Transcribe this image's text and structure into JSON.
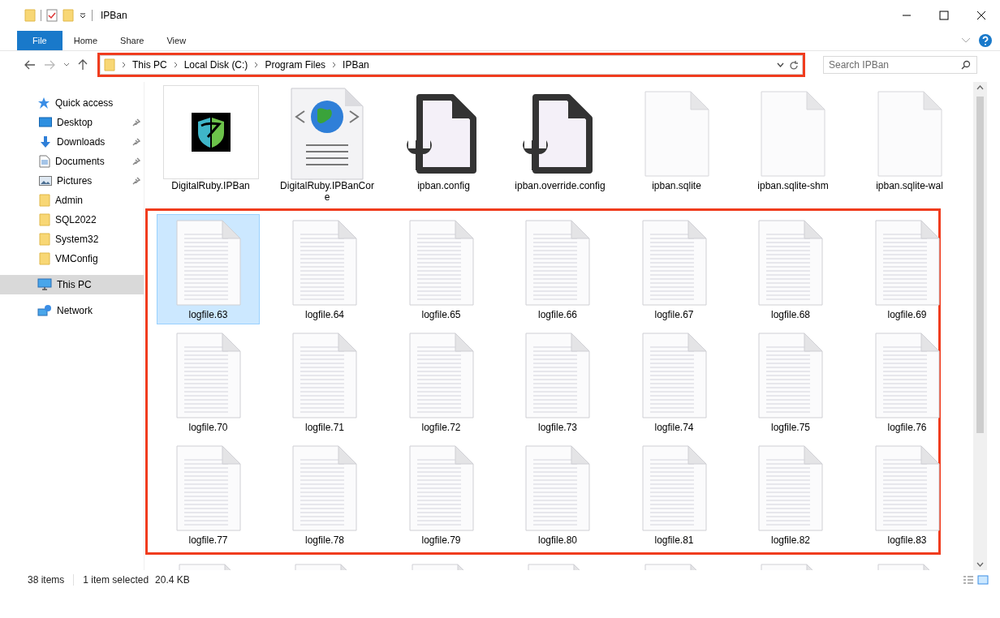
{
  "window": {
    "title": "IPBan"
  },
  "ribbon": {
    "tabs": [
      {
        "label": "File",
        "kind": "file"
      },
      {
        "label": "Home",
        "kind": "tab"
      },
      {
        "label": "Share",
        "kind": "tab"
      },
      {
        "label": "View",
        "kind": "tab"
      }
    ]
  },
  "address": {
    "crumbs": [
      "This PC",
      "Local Disk (C:)",
      "Program Files",
      "IPBan"
    ]
  },
  "search": {
    "placeholder": "Search IPBan"
  },
  "sidebar": {
    "items": [
      {
        "label": "Quick access",
        "kind": "star",
        "selected": false,
        "children": [
          {
            "label": "Desktop",
            "kind": "desktop",
            "pinned": true,
            "selected": false
          },
          {
            "label": "Downloads",
            "kind": "download",
            "pinned": true,
            "selected": false
          },
          {
            "label": "Documents",
            "kind": "documents",
            "pinned": true,
            "selected": false
          },
          {
            "label": "Pictures",
            "kind": "pictures",
            "pinned": true,
            "selected": false
          },
          {
            "label": "Admin",
            "kind": "folder",
            "pinned": false,
            "selected": false
          },
          {
            "label": "SQL2022",
            "kind": "folder",
            "pinned": false,
            "selected": false
          },
          {
            "label": "System32",
            "kind": "folder",
            "pinned": false,
            "selected": false
          },
          {
            "label": "VMConfig",
            "kind": "folder",
            "pinned": false,
            "selected": false
          }
        ]
      },
      {
        "label": "This PC",
        "kind": "pc",
        "selected": true
      },
      {
        "label": "Network",
        "kind": "network",
        "selected": false
      }
    ]
  },
  "files": [
    {
      "name": "DigitalRuby.IPBan",
      "kind": "logo",
      "selected": false
    },
    {
      "name": "DigitalRuby.IPBanCore",
      "kind": "web",
      "selected": false
    },
    {
      "name": "ipban.config",
      "kind": "config",
      "selected": false
    },
    {
      "name": "ipban.override.config",
      "kind": "config",
      "selected": false
    },
    {
      "name": "ipban.sqlite",
      "kind": "blank",
      "selected": false
    },
    {
      "name": "ipban.sqlite-shm",
      "kind": "blank",
      "selected": false
    },
    {
      "name": "ipban.sqlite-wal",
      "kind": "blank",
      "selected": false
    },
    {
      "name": "logfile.63",
      "kind": "text",
      "selected": true
    },
    {
      "name": "logfile.64",
      "kind": "text",
      "selected": false
    },
    {
      "name": "logfile.65",
      "kind": "text",
      "selected": false
    },
    {
      "name": "logfile.66",
      "kind": "text",
      "selected": false
    },
    {
      "name": "logfile.67",
      "kind": "text",
      "selected": false
    },
    {
      "name": "logfile.68",
      "kind": "text",
      "selected": false
    },
    {
      "name": "logfile.69",
      "kind": "text",
      "selected": false
    },
    {
      "name": "logfile.70",
      "kind": "text",
      "selected": false
    },
    {
      "name": "logfile.71",
      "kind": "text",
      "selected": false
    },
    {
      "name": "logfile.72",
      "kind": "text",
      "selected": false
    },
    {
      "name": "logfile.73",
      "kind": "text",
      "selected": false
    },
    {
      "name": "logfile.74",
      "kind": "text",
      "selected": false
    },
    {
      "name": "logfile.75",
      "kind": "text",
      "selected": false
    },
    {
      "name": "logfile.76",
      "kind": "text",
      "selected": false
    },
    {
      "name": "logfile.77",
      "kind": "text",
      "selected": false
    },
    {
      "name": "logfile.78",
      "kind": "text",
      "selected": false
    },
    {
      "name": "logfile.79",
      "kind": "text",
      "selected": false
    },
    {
      "name": "logfile.80",
      "kind": "text",
      "selected": false
    },
    {
      "name": "logfile.81",
      "kind": "text",
      "selected": false
    },
    {
      "name": "logfile.82",
      "kind": "text",
      "selected": false
    },
    {
      "name": "logfile.83",
      "kind": "text",
      "selected": false
    },
    {
      "kind": "text",
      "selected": false
    },
    {
      "kind": "text",
      "selected": false
    },
    {
      "kind": "text",
      "selected": false
    },
    {
      "kind": "text",
      "selected": false
    },
    {
      "kind": "text",
      "selected": false
    },
    {
      "kind": "text",
      "selected": false
    },
    {
      "kind": "text",
      "selected": false
    }
  ],
  "status_bar": {
    "item_count": "38 items",
    "selection": "1 item selected",
    "size": "20.4 KB"
  }
}
